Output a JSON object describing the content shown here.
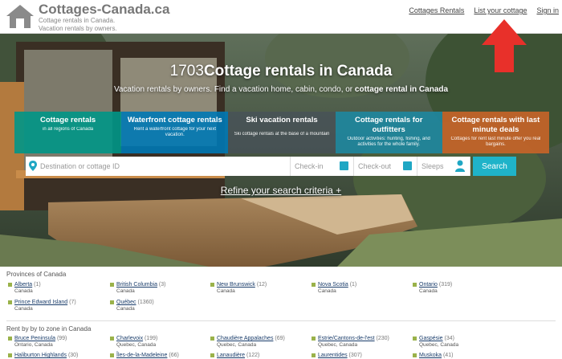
{
  "site": {
    "logo_title": "Cottages-Canada.ca",
    "logo_sub1": "Cottage rentals in Canada.",
    "logo_sub2": "Vacation rentals by owners."
  },
  "nav": [
    {
      "label": "Cottages Rentals"
    },
    {
      "label": "List your cottage"
    },
    {
      "label": "Sign in"
    }
  ],
  "hero": {
    "count": "1703",
    "title": "Cottage rentals in Canada",
    "subtitle_pre": "Vacation rentals by owners. Find a vacation home, cabin, condo, or ",
    "subtitle_bold": "cottage rental in Canada"
  },
  "categories": [
    {
      "title": "Cottage rentals",
      "desc": "in all regions of Canada"
    },
    {
      "title": "Waterfront cottage rentals",
      "desc": "Rent a waterfront cottage for your next vacation."
    },
    {
      "title": "Ski vacation rentals",
      "desc": "Ski cottage rentals at the base of a mountain"
    },
    {
      "title": "Cottage rentals for outfitters",
      "desc": "Outdoor activities: hunting, fishing, and activities for the whole family."
    },
    {
      "title": "Cottage rentals with last minute deals",
      "desc": "Cottages for rent last minute offer you real bargains."
    }
  ],
  "search": {
    "destination_placeholder": "Destination or cottage ID",
    "checkin_placeholder": "Check-in",
    "checkout_placeholder": "Check-out",
    "sleeps_placeholder": "Sleeps",
    "button": "Search",
    "refine": "Refine your search criteria +"
  },
  "provinces": {
    "heading": "Provinces of Canada",
    "items": [
      {
        "name": "Alberta",
        "count": "(1)",
        "region": "Canada"
      },
      {
        "name": "British Columbia",
        "count": "(3)",
        "region": "Canada"
      },
      {
        "name": "New Brunswick",
        "count": "(12)",
        "region": "Canada"
      },
      {
        "name": "Nova Scotia",
        "count": "(1)",
        "region": "Canada"
      },
      {
        "name": "Ontario",
        "count": "(319)",
        "region": "Canada"
      },
      {
        "name": "Prince Edward Island",
        "count": "(7)",
        "region": "Canada"
      },
      {
        "name": "Québec",
        "count": "(1360)",
        "region": "Canada"
      }
    ]
  },
  "zones": {
    "heading": "Rent by by to zone in Canada",
    "items": [
      {
        "name": "Bruce Peninsula",
        "count": "(99)",
        "region": "Ontario, Canada"
      },
      {
        "name": "Charlevoix",
        "count": "(199)",
        "region": "Quebec, Canada"
      },
      {
        "name": "Chaudière Appalaches",
        "count": "(69)",
        "region": "Quebec, Canada"
      },
      {
        "name": "Estrie/Cantons-de-l'est",
        "count": "(230)",
        "region": "Quebec, Canada"
      },
      {
        "name": "Gaspésie",
        "count": "(34)",
        "region": "Quebec, Canada"
      },
      {
        "name": "Haliburton Highlands",
        "count": "(30)",
        "region": ""
      },
      {
        "name": "Îles-de-la-Madeleine",
        "count": "(66)",
        "region": ""
      },
      {
        "name": "Lanaudière",
        "count": "(122)",
        "region": ""
      },
      {
        "name": "Laurentides",
        "count": "(307)",
        "region": ""
      },
      {
        "name": "Muskoka",
        "count": "(41)",
        "region": ""
      }
    ]
  },
  "colors": {
    "accent": "#1fb3c9",
    "annotation": "#e8302a",
    "bullet": "#9ab24a"
  }
}
